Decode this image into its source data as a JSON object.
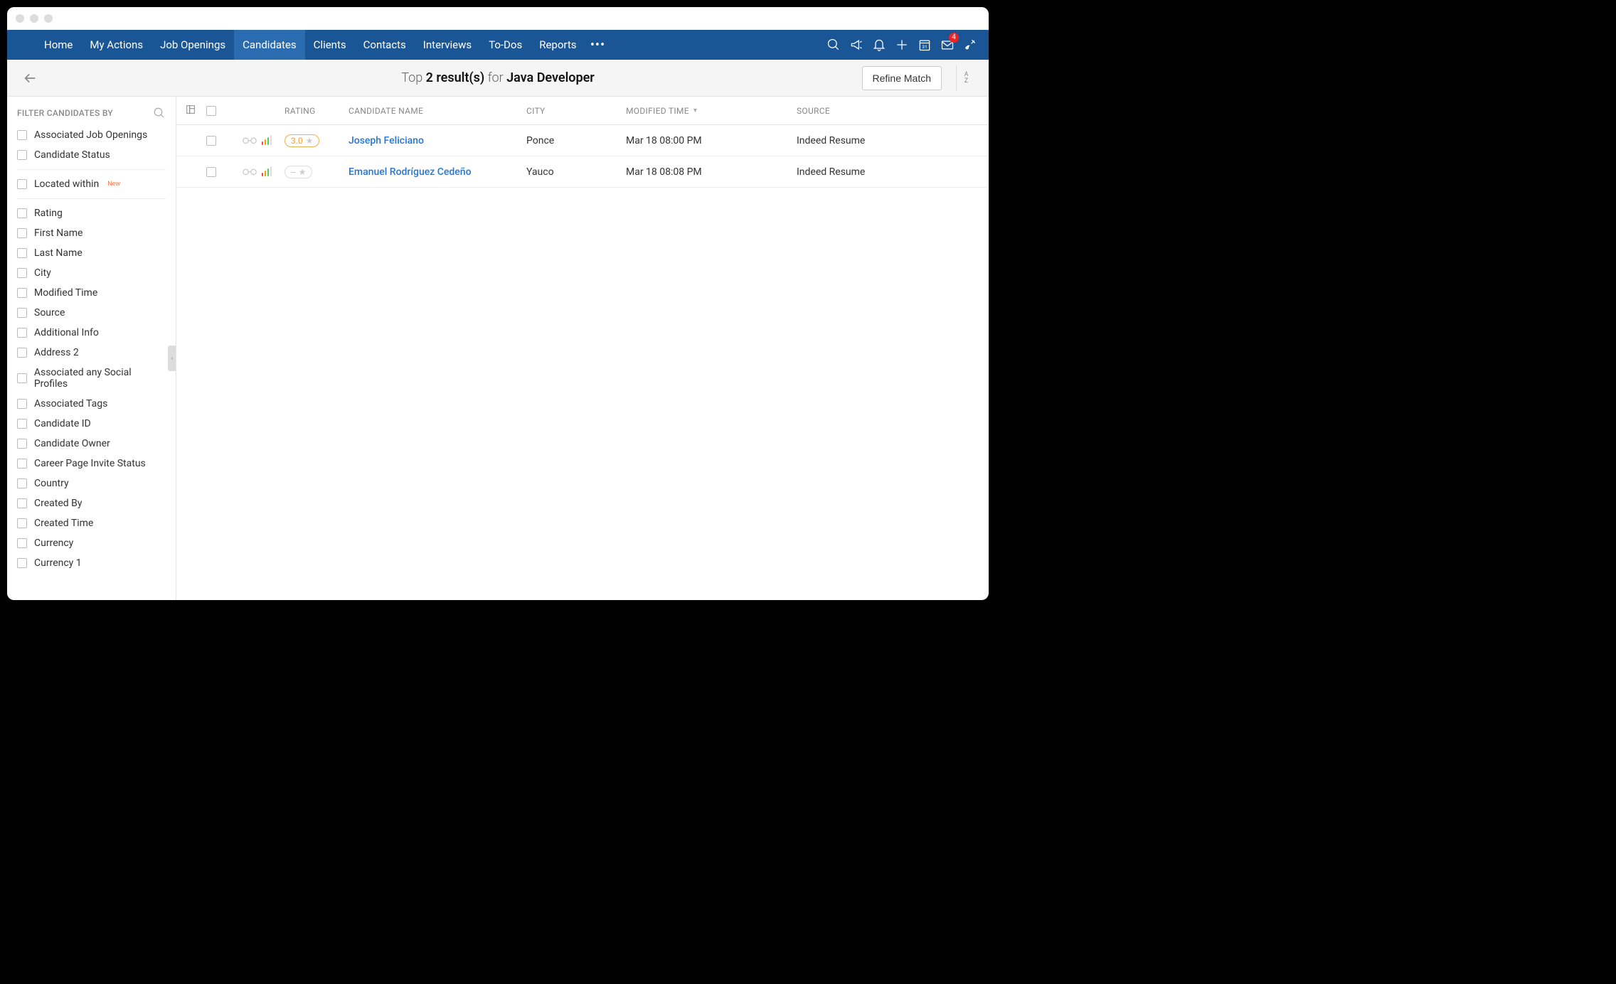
{
  "topnav": {
    "items": [
      "Home",
      "My Actions",
      "Job Openings",
      "Candidates",
      "Clients",
      "Contacts",
      "Interviews",
      "To-Dos",
      "Reports"
    ],
    "active_index": 3,
    "mail_badge": "4"
  },
  "subheader": {
    "prefix": "Top ",
    "count": "2 result(s)",
    "mid": " for ",
    "query": "Java Developer",
    "refine_label": "Refine Match"
  },
  "sidebar": {
    "title": "FILTER CANDIDATES BY",
    "group1": [
      "Associated Job Openings",
      "Candidate Status"
    ],
    "located": {
      "label": "Located within",
      "tag": "New"
    },
    "group2": [
      "Rating",
      "First Name",
      "Last Name",
      "City",
      "Modified Time",
      "Source",
      "Additional Info",
      "Address 2",
      "Associated any Social Profiles",
      "Associated Tags",
      "Candidate ID",
      "Candidate Owner",
      "Career Page Invite Status",
      "Country",
      "Created By",
      "Created Time",
      "Currency",
      "Currency 1"
    ]
  },
  "table": {
    "headers": {
      "rating": "RATING",
      "name": "CANDIDATE NAME",
      "city": "CITY",
      "modified": "MODIFIED TIME",
      "source": "SOURCE"
    },
    "rows": [
      {
        "name": "Joseph Feliciano",
        "city": "Ponce",
        "modified": "Mar 18 08:00 PM",
        "source": "Indeed Resume",
        "rating": "3.0",
        "has_rating": true
      },
      {
        "name": "Emanuel Rodríguez Cedeño",
        "city": "Yauco",
        "modified": "Mar 18 08:08 PM",
        "source": "Indeed Resume",
        "rating": "--",
        "has_rating": false
      }
    ]
  }
}
